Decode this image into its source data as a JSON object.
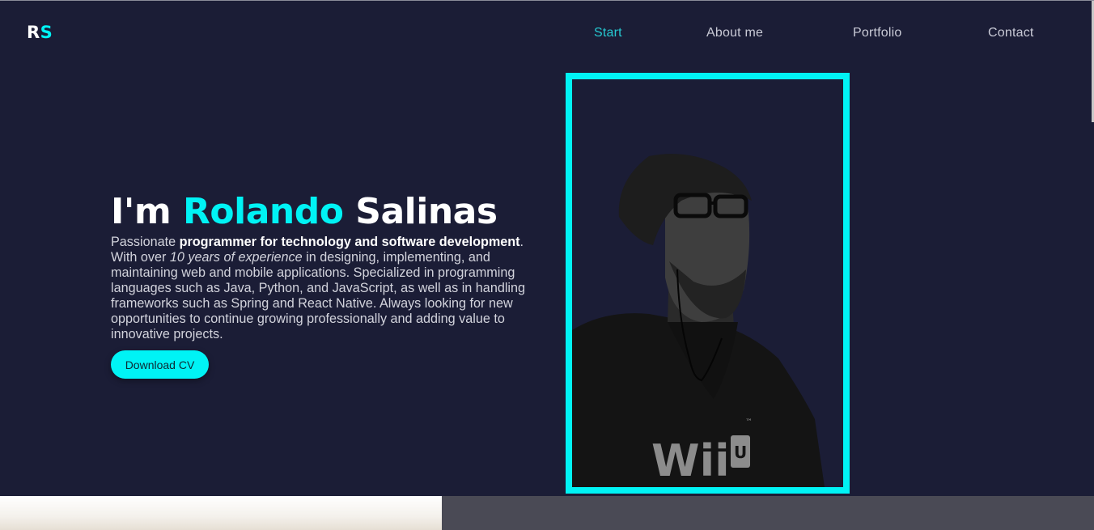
{
  "logo": {
    "part1": "R",
    "part2": "S"
  },
  "nav": {
    "items": [
      {
        "label": "Start",
        "active": true
      },
      {
        "label": "About me",
        "active": false
      },
      {
        "label": "Portfolio",
        "active": false
      },
      {
        "label": "Contact",
        "active": false
      }
    ]
  },
  "hero": {
    "title_prefix": "I'm ",
    "first_name": "Rolando",
    "last_name": " Salinas",
    "desc_1": "Passionate ",
    "desc_bold": "programmer for technology and software development",
    "desc_2": ". With over ",
    "desc_italic": "10 years of experience",
    "desc_3": " in designing, implementing, and maintaining web and mobile applications. Specialized in programming languages such as Java, Python, and JavaScript, as well as in handling frameworks such as Spring and React Native. Always looking for new opportunities to continue growing professionally and adding value to innovative projects.",
    "cv_button_label": "Download CV"
  },
  "photo": {
    "shirt_text": "Wii",
    "shirt_badge": "U",
    "shirt_tm": "™"
  },
  "colors": {
    "background": "#1b1d36",
    "accent": "#00f3f5",
    "nav_active": "#26c9d1",
    "text": "#d2d3dc"
  }
}
